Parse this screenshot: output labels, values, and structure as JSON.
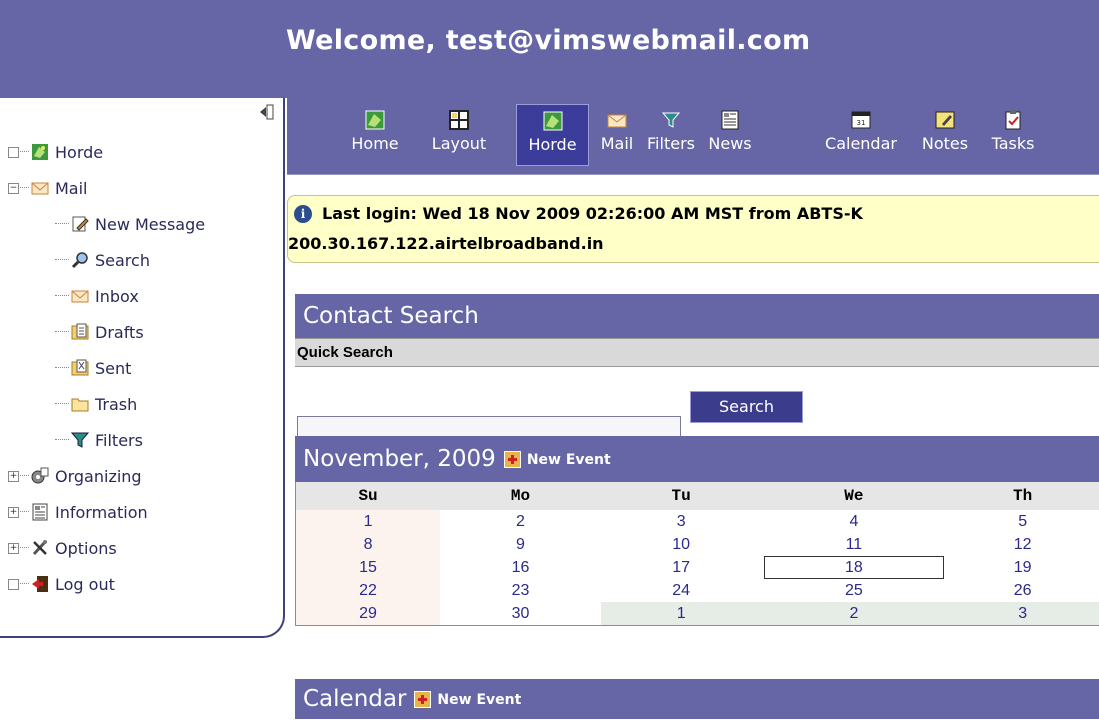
{
  "header": {
    "title": "Welcome, test@vimswebmail.com"
  },
  "sidebar": {
    "items": [
      {
        "label": "Horde",
        "icon": "horde-icon"
      },
      {
        "label": "Mail",
        "icon": "mail-icon"
      },
      {
        "label": "New Message",
        "icon": "compose-icon"
      },
      {
        "label": "Search",
        "icon": "search-icon"
      },
      {
        "label": "Inbox",
        "icon": "inbox-icon"
      },
      {
        "label": "Drafts",
        "icon": "drafts-icon"
      },
      {
        "label": "Sent",
        "icon": "sent-icon"
      },
      {
        "label": "Trash",
        "icon": "trash-icon"
      },
      {
        "label": "Filters",
        "icon": "filter-icon"
      },
      {
        "label": "Organizing",
        "icon": "organizing-icon"
      },
      {
        "label": "Information",
        "icon": "information-icon"
      },
      {
        "label": "Options",
        "icon": "options-icon"
      },
      {
        "label": "Log out",
        "icon": "logout-icon"
      }
    ]
  },
  "nav": {
    "buttons": [
      {
        "label": "Home",
        "icon": "home-icon"
      },
      {
        "label": "Layout",
        "icon": "layout-icon"
      },
      {
        "label": "Horde",
        "icon": "horde-icon",
        "active": true
      },
      {
        "label": "Mail",
        "icon": "mail-icon"
      },
      {
        "label": "Filters",
        "icon": "filter-icon"
      },
      {
        "label": "News",
        "icon": "news-icon"
      },
      {
        "label": "Calendar",
        "icon": "calendar-icon"
      },
      {
        "label": "Notes",
        "icon": "notes-icon"
      },
      {
        "label": "Tasks",
        "icon": "tasks-icon"
      }
    ]
  },
  "notice": {
    "line1": "Last login: Wed 18 Nov 2009 02:26:00 AM MST from ABTS-K",
    "line2": "200.30.167.122.airtelbroadband.in"
  },
  "contact_search": {
    "title": "Contact Search",
    "quick_search": "Quick Search",
    "search_value": "",
    "search_button": "Search"
  },
  "calendar": {
    "month_title": "November, 2009",
    "new_event": "New Event",
    "days": [
      "Su",
      "Mo",
      "Tu",
      "We",
      "Th"
    ],
    "weeks": [
      [
        "1",
        "2",
        "3",
        "4",
        "5"
      ],
      [
        "8",
        "9",
        "10",
        "11",
        "12"
      ],
      [
        "15",
        "16",
        "17",
        "18",
        "19"
      ],
      [
        "22",
        "23",
        "24",
        "25",
        "26"
      ],
      [
        "29",
        "30",
        "1",
        "2",
        "3"
      ]
    ],
    "today": "18"
  },
  "calendar2": {
    "title": "Calendar",
    "new_event": "New Event"
  },
  "colors": {
    "header_bg": "#6666a7",
    "active_nav": "#3c3c9a",
    "notice_bg": "#ffffc8"
  }
}
